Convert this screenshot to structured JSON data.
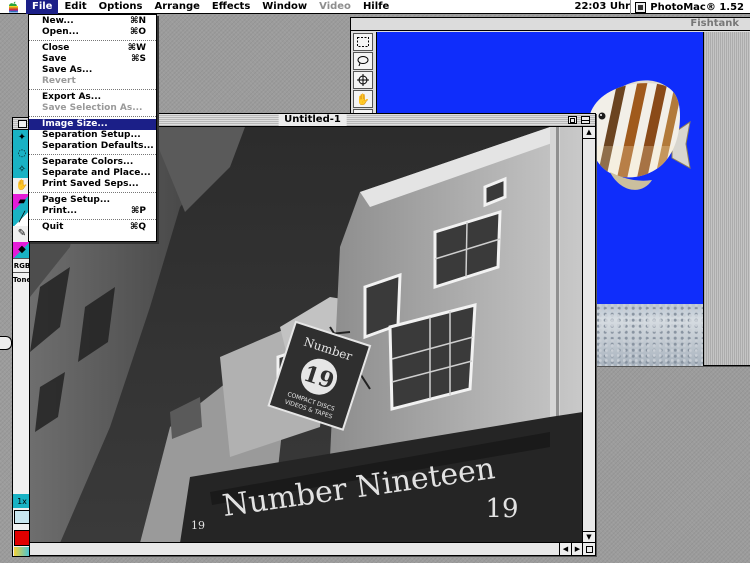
{
  "menubar": {
    "menus": [
      {
        "label": "File",
        "active": true
      },
      {
        "label": "Edit"
      },
      {
        "label": "Options"
      },
      {
        "label": "Arrange"
      },
      {
        "label": "Effects"
      },
      {
        "label": "Window"
      },
      {
        "label": "Video",
        "disabled": true
      },
      {
        "label": "Hilfe"
      }
    ],
    "clock": "22:03 Uhr",
    "app_name": "PhotoMac® 1.52"
  },
  "file_menu": {
    "items": [
      {
        "label": "New...",
        "shortcut": "⌘N"
      },
      {
        "label": "Open...",
        "shortcut": "⌘O"
      },
      {
        "label": "Close",
        "shortcut": "⌘W"
      },
      {
        "label": "Save",
        "shortcut": "⌘S"
      },
      {
        "label": "Save As..."
      },
      {
        "label": "Revert",
        "disabled": true
      },
      {
        "label": "Export As..."
      },
      {
        "label": "Save Selection As...",
        "disabled": true
      },
      {
        "label": "Image Size...",
        "highlighted": true
      },
      {
        "label": "Separation Setup..."
      },
      {
        "label": "Separation Defaults..."
      },
      {
        "label": "Separate Colors..."
      },
      {
        "label": "Separate and Place..."
      },
      {
        "label": "Print Saved Seps..."
      },
      {
        "label": "Page Setup..."
      },
      {
        "label": "Print...",
        "shortcut": "⌘P"
      },
      {
        "label": "Quit",
        "shortcut": "⌘Q"
      }
    ]
  },
  "fishtank_window": {
    "title": "Fishtank"
  },
  "document_window": {
    "title": "Untitled-1",
    "photo": {
      "sign_word": "Number",
      "sign_number": "19",
      "sign_lines": [
        "COMPACT DISCS",
        "VIDEOS & TAPES"
      ],
      "fascia_text": "Number Nineteen",
      "fascia_number": "19",
      "fascia_small": "19"
    }
  },
  "toolbar": {
    "rgb_label": "RGB",
    "tone_label": "Tone",
    "zoom_label": "1x"
  },
  "colors": {
    "menu_highlight": "#1b1f88",
    "fishtank_blue": "#0f2dfb",
    "tool_teal": "#19b2c4",
    "foreground_color": "#e00000"
  }
}
